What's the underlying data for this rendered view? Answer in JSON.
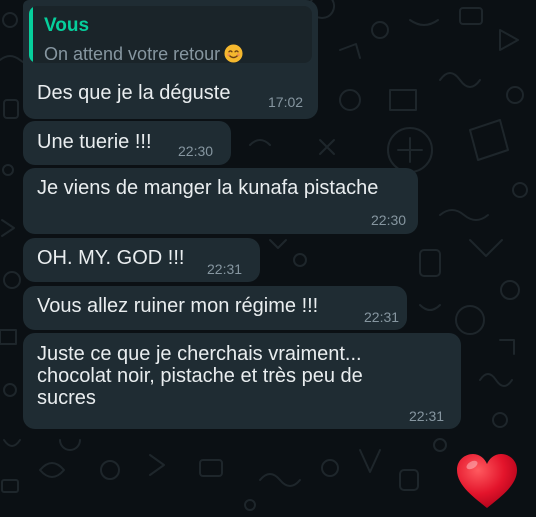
{
  "colors": {
    "background": "#0b1014",
    "bubble": "#1f2c33",
    "text": "#e9edef",
    "time": "#8696a0",
    "quote_accent": "#06cf9c",
    "heart": "#e3142b"
  },
  "messages": [
    {
      "quote": {
        "author": "Vous",
        "text": "On attend votre retour",
        "emoji": "smiling-face-icon"
      },
      "text": "Des que je la déguste",
      "time": "17:02"
    },
    {
      "text": "Une tuerie !!!",
      "time": "22:30"
    },
    {
      "text": "Je viens de manger la kunafa pistache",
      "time": "22:30"
    },
    {
      "text": "OH. MY. GOD !!!",
      "time": "22:31"
    },
    {
      "text": "Vous allez ruiner mon régime !!!",
      "time": "22:31"
    },
    {
      "text": "Juste ce que je cherchais vraiment...\nchocolat noir, pistache et très peu de\nsucres",
      "time": "22:31"
    }
  ],
  "reaction": {
    "icon": "red-heart-icon"
  }
}
